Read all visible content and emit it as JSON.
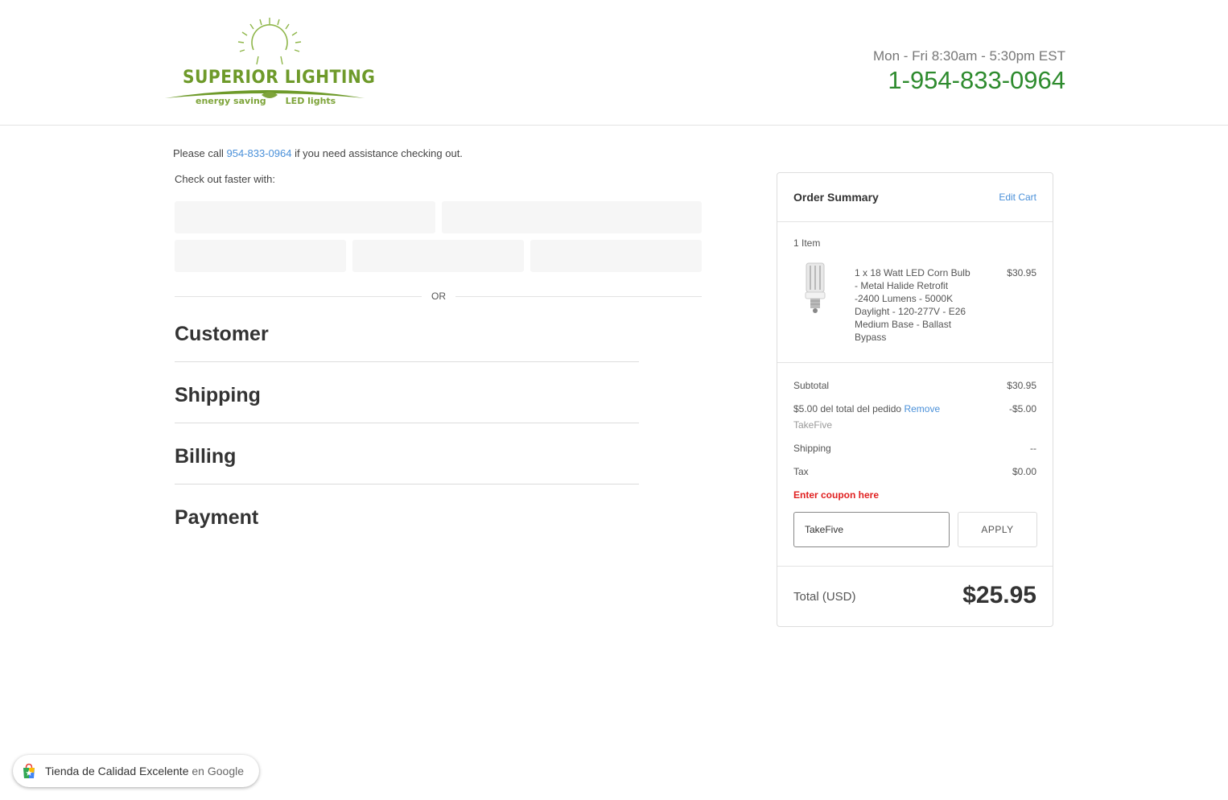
{
  "header": {
    "logo_main": "SUPERIOR  LIGHTING",
    "logo_sub_left": "energy saving",
    "logo_sub_right": "LED lights",
    "hours": "Mon - Fri 8:30am - 5:30pm EST",
    "phone": "1-954-833-0964"
  },
  "checkout": {
    "assist_prefix": "Please call ",
    "assist_phone": "954-833-0964",
    "assist_suffix": " if you need assistance checking out.",
    "faster_label": "Check out faster with:",
    "or_label": "OR",
    "steps": [
      "Customer",
      "Shipping",
      "Billing",
      "Payment"
    ]
  },
  "summary": {
    "title": "Order Summary",
    "edit_cart": "Edit Cart",
    "item_count": "1 Item",
    "item": {
      "name": "1 x 18 Watt LED Corn Bulb - Metal Halide Retrofit -2400 Lumens - 5000K Daylight - 120-277V - E26 Medium Base - Ballast Bypass",
      "price": "$30.95"
    },
    "subtotal_label": "Subtotal",
    "subtotal_value": "$30.95",
    "discount_label": "$5.00 del total del pedido",
    "discount_remove": "Remove",
    "discount_code": "TakeFive",
    "discount_value": "-$5.00",
    "shipping_label": "Shipping",
    "shipping_value": "--",
    "tax_label": "Tax",
    "tax_value": "$0.00",
    "coupon_link": "Enter coupon here",
    "coupon_value": "TakeFive",
    "apply_label": "APPLY",
    "total_label": "Total (USD)",
    "total_value": "$25.95"
  },
  "badge": {
    "text": "Tienda de Calidad Excelente",
    "suffix": "en Google"
  },
  "colors": {
    "brand_green": "#6e9a2a",
    "phone_green": "#2e8b2e",
    "link_blue": "#4a90d9",
    "coupon_red": "#e02020"
  }
}
